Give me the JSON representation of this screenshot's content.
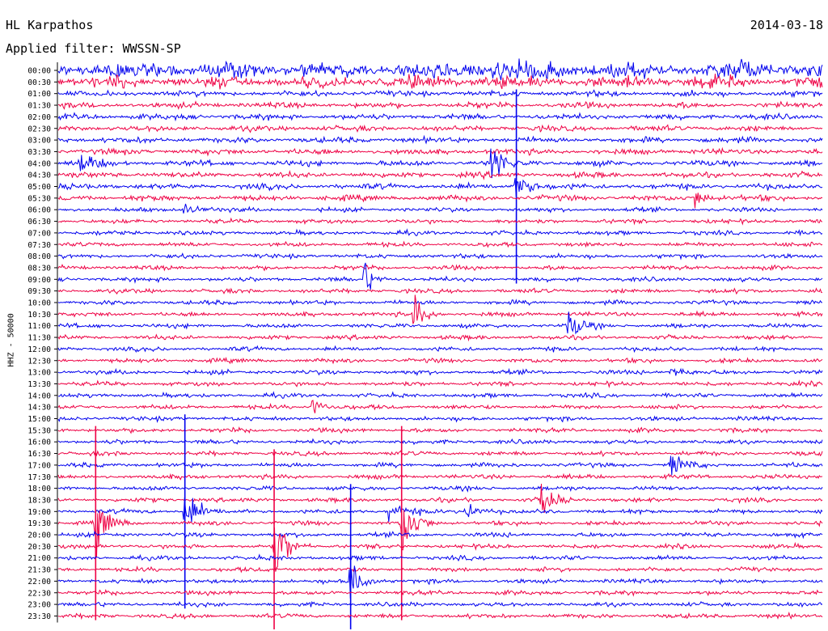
{
  "header": {
    "station": "HL Karpathos",
    "date": "2014-03-18",
    "filter_label": "Applied filter: WWSSN-SP"
  },
  "axis": {
    "ylabel": "HHZ - 50000"
  },
  "colors": {
    "trace_a": "#0000ee",
    "trace_b": "#ee0044",
    "axis": "#000000"
  },
  "chart_data": {
    "type": "line",
    "title": "",
    "xlabel": "",
    "ylabel": "HHZ - 50000",
    "rows": [
      "00:00",
      "00:30",
      "01:00",
      "01:30",
      "02:00",
      "02:30",
      "03:00",
      "03:30",
      "04:00",
      "04:30",
      "05:00",
      "05:30",
      "06:00",
      "06:30",
      "07:00",
      "07:30",
      "08:00",
      "08:30",
      "09:00",
      "09:30",
      "10:00",
      "10:30",
      "11:00",
      "11:30",
      "12:00",
      "12:30",
      "13:00",
      "13:30",
      "14:00",
      "14:30",
      "15:00",
      "15:30",
      "16:00",
      "16:30",
      "17:00",
      "17:30",
      "18:00",
      "18:30",
      "19:00",
      "19:30",
      "20:00",
      "20:30",
      "21:00",
      "21:30",
      "22:00",
      "22:30",
      "23:00",
      "23:30"
    ],
    "row_colors_cycle": [
      "blue",
      "red"
    ],
    "grid": false,
    "events": [
      {
        "row": "00:00",
        "minute": 17,
        "amplitude": 1.4
      },
      {
        "row": "04:00",
        "minute": 17,
        "amplitude": 1.6
      },
      {
        "row": "04:00",
        "minute": 0.85,
        "amplitude": 0.9
      },
      {
        "row": "05:00",
        "minute": 18,
        "amplitude": 2.2
      },
      {
        "row": "05:30",
        "minute": 25,
        "amplitude": 1.3
      },
      {
        "row": "06:00",
        "minute": 5,
        "amplitude": 0.8
      },
      {
        "row": "09:00",
        "minute": 12,
        "amplitude": 1.6
      },
      {
        "row": "10:30",
        "minute": 14,
        "amplitude": 1.5
      },
      {
        "row": "11:00",
        "minute": 20,
        "amplitude": 1.2
      },
      {
        "row": "13:00",
        "minute": 24,
        "amplitude": 1.0
      },
      {
        "row": "14:30",
        "minute": 10,
        "amplitude": 1.1
      },
      {
        "row": "17:00",
        "minute": 24,
        "amplitude": 1.2
      },
      {
        "row": "18:30",
        "minute": 19,
        "amplitude": 1.3
      },
      {
        "row": "19:00",
        "minute": 5,
        "amplitude": 2.5
      },
      {
        "row": "19:00",
        "minute": 13,
        "amplitude": 1.3
      },
      {
        "row": "19:00",
        "minute": 16,
        "amplitude": 1.5
      },
      {
        "row": "19:30",
        "minute": 1.5,
        "amplitude": 2.0
      },
      {
        "row": "19:30",
        "minute": 13.5,
        "amplitude": 2.6
      },
      {
        "row": "20:30",
        "minute": 8.5,
        "amplitude": 2.5
      },
      {
        "row": "22:00",
        "minute": 11.5,
        "amplitude": 2.2
      }
    ]
  }
}
